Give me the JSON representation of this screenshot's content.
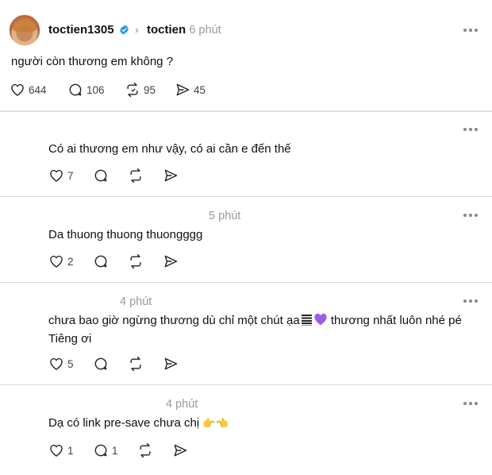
{
  "post": {
    "username": "toctien1305",
    "reply_to": "toctien",
    "time": "6 phút",
    "text": "người còn thương em không ?",
    "likes": "644",
    "comments": "106",
    "reposts": "95",
    "shares": "45"
  },
  "replies": [
    {
      "time": "",
      "text": "Có ai thương em như vậy, có ai cần e đến thế",
      "likes": "7",
      "comments": ""
    },
    {
      "time": "5 phút",
      "text": "Da thuong thuong thuongggg",
      "likes": "2",
      "comments": ""
    },
    {
      "time": "4 phút",
      "text_line1": "chưa bao giờ ngừng thương dù chỉ một chút ạa",
      "text_line1b": "thương nhất luôn nhé pé",
      "text_line2": "Tiêng ơi",
      "likes": "5",
      "comments": ""
    },
    {
      "time": "4 phút",
      "text": "Dạ có link pre-save chưa chị",
      "likes": "1",
      "comments": "1"
    }
  ],
  "icons": {
    "verified": "verified-badge-icon",
    "like": "heart-icon",
    "comment": "comment-bubble-icon",
    "repost": "repost-icon",
    "share": "send-icon",
    "more": "more-dots-icon",
    "purple_heart": "purple-heart-emoji",
    "hand": "pointing-hand-emoji",
    "bars": "bar-emoji"
  },
  "colors": {
    "verified": "#1d9bf0",
    "text": "#101010",
    "muted": "#9a9a9a",
    "divider": "#dcdcdc",
    "purple_heart": "#9b5de5"
  }
}
